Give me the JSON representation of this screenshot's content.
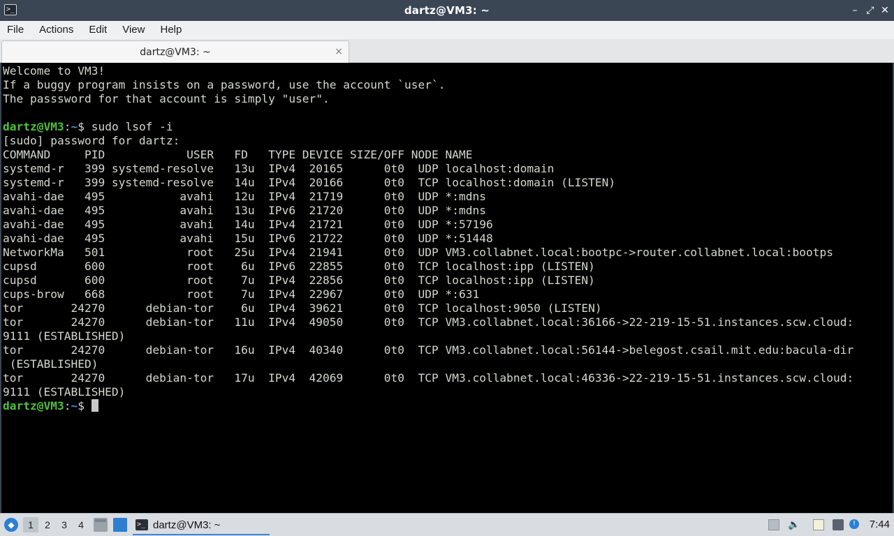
{
  "window": {
    "title": "dartz@VM3: ~",
    "icon": "terminal-icon",
    "controls": [
      "minimize",
      "maximize",
      "close"
    ]
  },
  "menubar": {
    "items": [
      "File",
      "Actions",
      "Edit",
      "View",
      "Help"
    ]
  },
  "tabs": [
    {
      "label": "dartz@VM3: ~",
      "close_glyph": "×",
      "active": true
    }
  ],
  "terminal": {
    "prompt": {
      "user_host": "dartz@VM3",
      "sep": ":",
      "path": "~",
      "symbol": "$ "
    },
    "welcome": [
      "Welcome to VM3!",
      "If a buggy program insists on a password, use the account `user`.",
      "The passsword for that account is simply \"user\"."
    ],
    "command": "sudo lsof -i",
    "sudo_prompt": "[sudo] password for dartz:",
    "output": [
      "COMMAND     PID            USER   FD   TYPE DEVICE SIZE/OFF NODE NAME",
      "systemd-r   399 systemd-resolve   13u  IPv4  20165      0t0  UDP localhost:domain",
      "systemd-r   399 systemd-resolve   14u  IPv4  20166      0t0  TCP localhost:domain (LISTEN)",
      "avahi-dae   495           avahi   12u  IPv4  21719      0t0  UDP *:mdns",
      "avahi-dae   495           avahi   13u  IPv6  21720      0t0  UDP *:mdns",
      "avahi-dae   495           avahi   14u  IPv4  21721      0t0  UDP *:57196",
      "avahi-dae   495           avahi   15u  IPv6  21722      0t0  UDP *:51448",
      "NetworkMa   501            root   25u  IPv4  21941      0t0  UDP VM3.collabnet.local:bootpc->router.collabnet.local:bootps",
      "cupsd       600            root    6u  IPv6  22855      0t0  TCP localhost:ipp (LISTEN)",
      "cupsd       600            root    7u  IPv4  22856      0t0  TCP localhost:ipp (LISTEN)",
      "cups-brow   668            root    7u  IPv4  22967      0t0  UDP *:631",
      "tor       24270      debian-tor    6u  IPv4  39621      0t0  TCP localhost:9050 (LISTEN)",
      "tor       24270      debian-tor   11u  IPv4  49050      0t0  TCP VM3.collabnet.local:36166->22-219-15-51.instances.scw.cloud:",
      "9111 (ESTABLISHED)",
      "tor       24270      debian-tor   16u  IPv4  40340      0t0  TCP VM3.collabnet.local:56144->belegost.csail.mit.edu:bacula-dir",
      " (ESTABLISHED)",
      "tor       24270      debian-tor   17u  IPv4  42069      0t0  TCP VM3.collabnet.local:46336->22-219-15-51.instances.scw.cloud:",
      "9111 (ESTABLISHED)"
    ]
  },
  "taskbar": {
    "workspaces": [
      "1",
      "2",
      "3",
      "4"
    ],
    "active_workspace": "1",
    "task_label": "dartz@VM3: ~",
    "clock": "7:44",
    "accent": "#3a86d4"
  }
}
